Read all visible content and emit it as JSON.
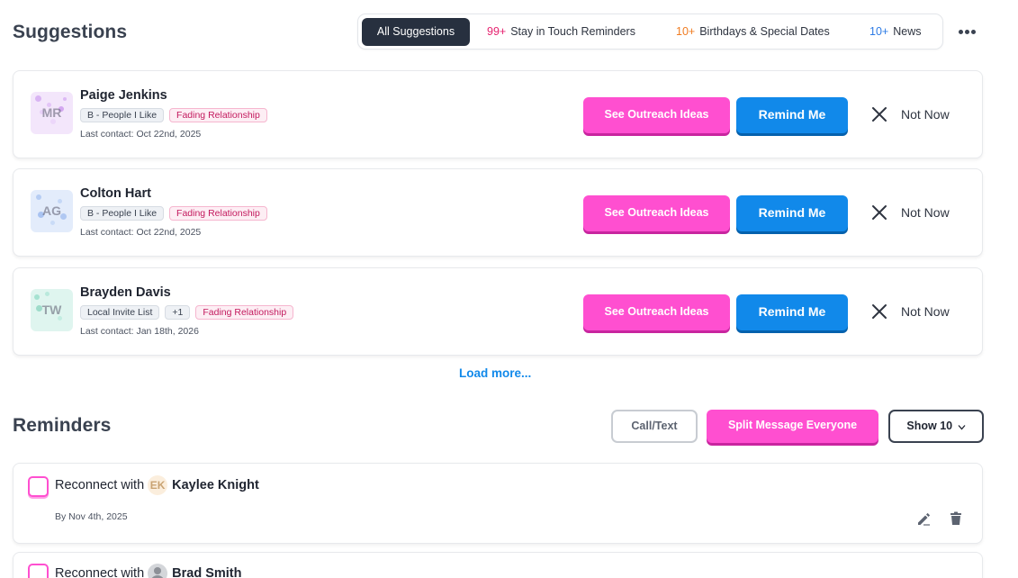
{
  "suggestions": {
    "title": "Suggestions",
    "filters": [
      {
        "count": "",
        "label": "All Suggestions",
        "active": true
      },
      {
        "count": "99+",
        "label": "Stay in Touch Reminders"
      },
      {
        "count": "10+",
        "label": "Birthdays & Special Dates"
      },
      {
        "count": "10+",
        "label": "News"
      }
    ],
    "people": [
      {
        "name": "Paige Jenkins",
        "initials": "MR",
        "tags": [
          "B - People I Like",
          "Fading Relationship"
        ],
        "last_contact": "Last contact: Oct 22nd, 2025"
      },
      {
        "name": "Colton Hart",
        "initials": "AG",
        "tags": [
          "B - People I Like",
          "Fading Relationship"
        ],
        "last_contact": "Last contact: Oct 22nd, 2025"
      },
      {
        "name": "Brayden Davis",
        "initials": "TW",
        "tags": [
          "Local Invite List",
          "+1",
          "Fading Relationship"
        ],
        "last_contact": "Last contact: Jan 18th, 2026"
      }
    ],
    "outreach_label": "See Outreach Ideas",
    "remind_label": "Remind Me",
    "notnow_label": "Not Now",
    "load_more": "Load more..."
  },
  "reminders": {
    "title": "Reminders",
    "call_text_label": "Call/Text",
    "split_label": "Split Message Everyone",
    "show_label": "Show 10",
    "items": [
      {
        "prefix": "Reconnect with",
        "initials": "EK",
        "name": "Kaylee Knight",
        "due": "By Nov 4th, 2025"
      },
      {
        "prefix": "Reconnect with",
        "initials": "",
        "name": "Brad Smith",
        "due": ""
      }
    ]
  },
  "colors": {
    "pink": "#ff4fd0",
    "blue": "#1189ea",
    "dark": "#27303f",
    "count_stay": "#e6226f",
    "count_birthdays": "#f07c22",
    "count_news": "#2d7be5"
  },
  "icons": [
    "more-icon",
    "close-icon",
    "chevron-down-icon",
    "edit-icon",
    "trash-icon"
  ]
}
